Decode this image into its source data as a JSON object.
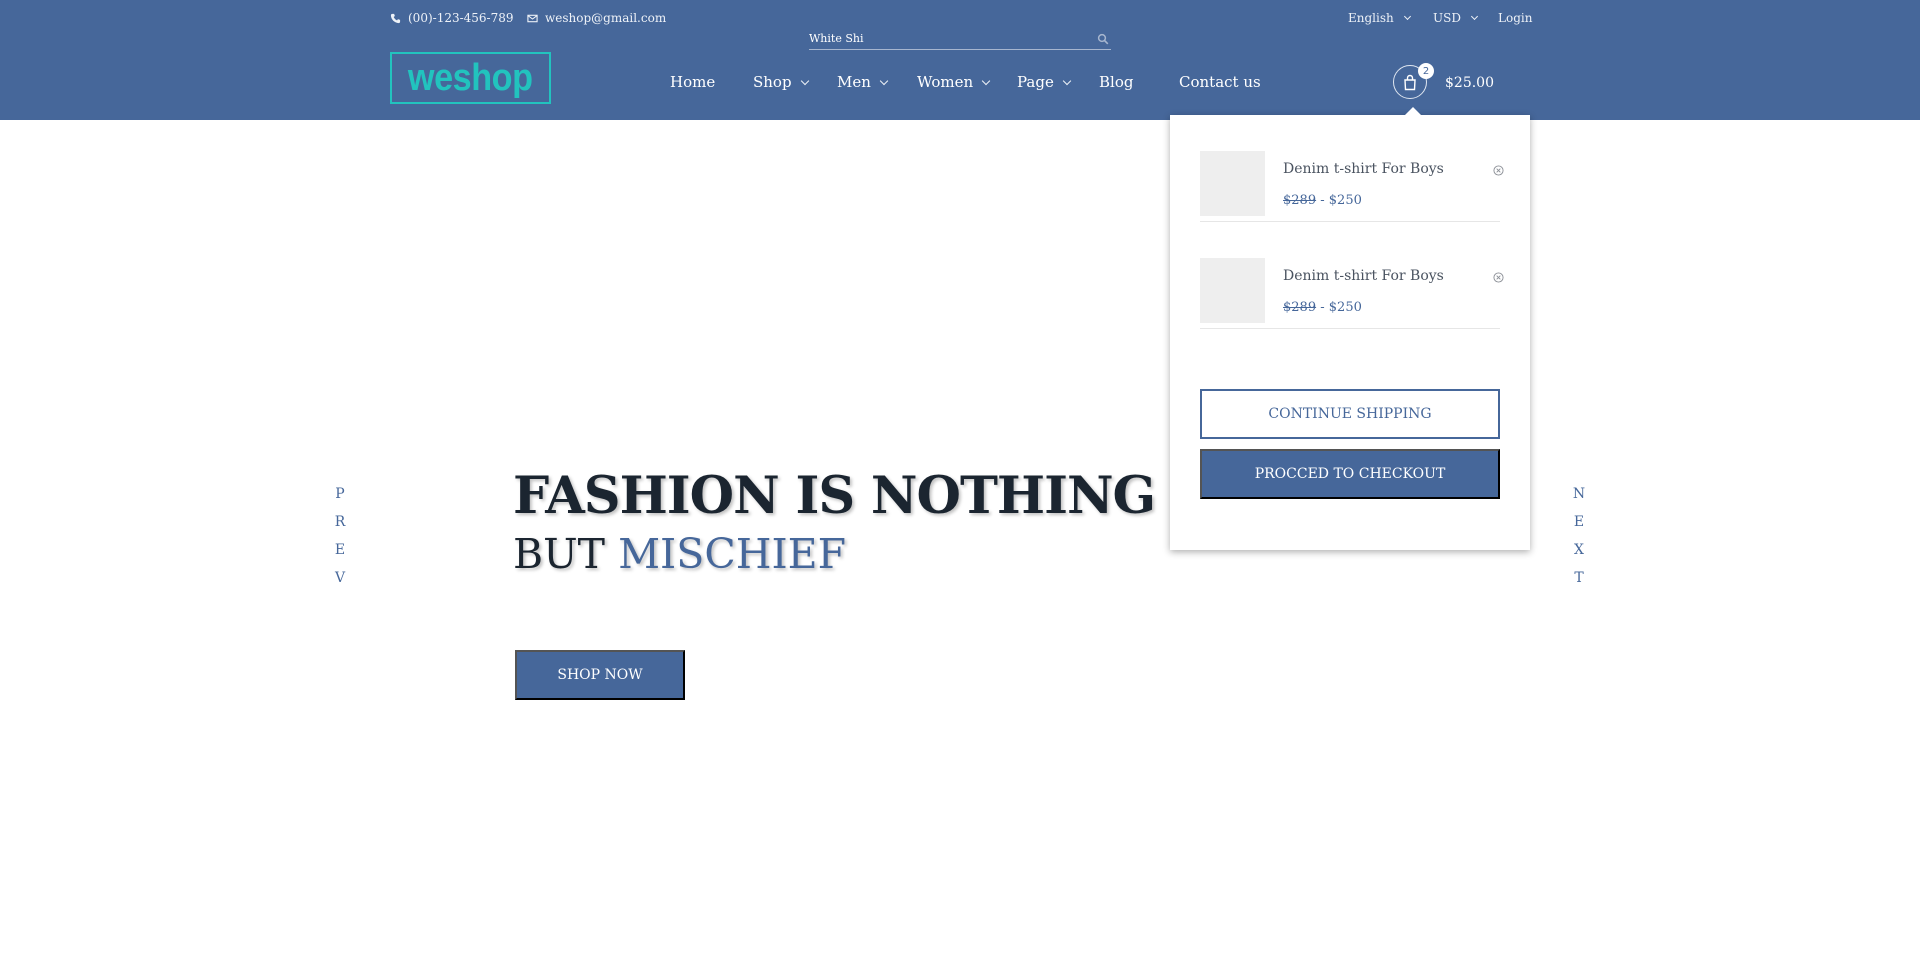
{
  "topbar": {
    "phone": "(00)-123-456-789",
    "email": "weshop@gmail.com",
    "language": "English",
    "currency": "USD",
    "login": "Login"
  },
  "search": {
    "value": "White Shi"
  },
  "logo": {
    "text": "weshop"
  },
  "nav": {
    "home": "Home",
    "shop": "Shop",
    "men": "Men",
    "women": "Women",
    "page": "Page",
    "blog": "Blog",
    "contact": "Contact us"
  },
  "cart": {
    "count": "2",
    "total": "$25.00",
    "items": [
      {
        "name": "Denim t-shirt For Boys",
        "old_price": "$289",
        "separator": "-",
        "price": "$250"
      },
      {
        "name": "Denim t-shirt For Boys",
        "old_price": "$289",
        "separator": "-",
        "price": "$250"
      }
    ],
    "continue_label": "CONTINUE SHIPPING",
    "checkout_label": "PROCCED TO CHECKOUT"
  },
  "slider": {
    "prev": [
      "P",
      "R",
      "E",
      "V"
    ],
    "next": [
      "N",
      "E",
      "X",
      "T"
    ]
  },
  "hero": {
    "line1": "FASHION IS NOTHING",
    "line2_plain": "BUT",
    "line2_accent": "MISCHIEF",
    "cta": "SHOP NOW"
  },
  "colors": {
    "brand": "#46679a",
    "logo": "#22c3be",
    "heading": "#1b2530"
  },
  "icons": {
    "phone": "phone-icon",
    "email": "envelope-icon",
    "search": "search-icon",
    "cart": "shopping-bag-icon",
    "remove": "close-circle-icon"
  }
}
